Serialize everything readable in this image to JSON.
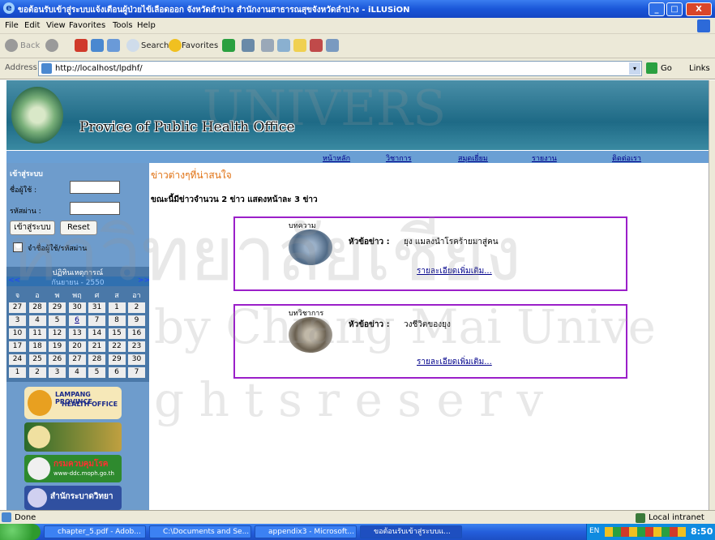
{
  "window": {
    "title": "ขอต้อนรับเข้าสู่ระบบแจ้งเตือนผู้ป่วยไข้เลือดออก จังหวัดลำปาง สำนักงานสาธารณสุขจังหวัดลำปาง - iLLUSiON"
  },
  "menu": [
    "File",
    "Edit",
    "View",
    "Favorites",
    "Tools",
    "Help"
  ],
  "toolbar": {
    "back": "Back",
    "search": "Search",
    "favorites": "Favorites"
  },
  "address": {
    "label": "Address",
    "url": "http://localhost/lpdhf/",
    "go": "Go",
    "links": "Links"
  },
  "banner": {
    "title": "Provice of Public Health Office"
  },
  "nav": [
    "หน้าหลัก",
    "วิชาการ",
    "สมุดเยี่ยม",
    "รายงาน",
    "ติดต่อเรา"
  ],
  "login": {
    "heading": "เข้าสู่ระบบ",
    "user_label": "ชื่อผู้ใช้ :",
    "pass_label": "รหัสผ่าน :",
    "login_button": "เข้าสู่ระบบ",
    "reset_button": "Reset",
    "remember": "จำชื่อผู้ใช้/รหัสผ่าน"
  },
  "calendar": {
    "title": "ปฏิทินเหตุการณ์",
    "month": "กันยายน - 2550",
    "prev": "<<",
    "next": ">>",
    "days": [
      "จ",
      "อ",
      "พ",
      "พฤ",
      "ศ",
      "ส",
      "อา"
    ],
    "weeks": [
      [
        "27",
        "28",
        "29",
        "30",
        "31",
        "1",
        "2"
      ],
      [
        "3",
        "4",
        "5",
        "6",
        "7",
        "8",
        "9"
      ],
      [
        "10",
        "11",
        "12",
        "13",
        "14",
        "15",
        "16"
      ],
      [
        "17",
        "18",
        "19",
        "20",
        "21",
        "22",
        "23"
      ],
      [
        "24",
        "25",
        "26",
        "27",
        "28",
        "29",
        "30"
      ],
      [
        "1",
        "2",
        "3",
        "4",
        "5",
        "6",
        "7"
      ]
    ]
  },
  "logos": {
    "lampang": [
      "LAMPANG PROVINCE",
      "HEALTH OFFICE"
    ],
    "dcc": [
      "กรมควบคุมโรค",
      "www-ddc.moph.go.th"
    ],
    "bureau": "สำนักระบาดวิทยา"
  },
  "news": {
    "heading": "ข่าวต่างๆที่น่าสนใจ",
    "count_text": "ขณะนี้มีข่าวจำนวน 2 ข่าว แสดงหน้าละ 3 ข่าว",
    "items": [
      {
        "category": "บทความ",
        "label": "หัวข้อข่าว :",
        "title": "ยุง แมลงนำโรคร้ายมาสู่คน",
        "more": "รายละเอียดเพิ่มเติม..."
      },
      {
        "category": "บทวิชาการ",
        "label": "หัวข้อข่าว :",
        "title": "วงชีวิตของยุง",
        "more": "รายละเอียดเพิ่มเติม..."
      }
    ]
  },
  "watermark": {
    "line1": "UNIVERS",
    "line2": "หาวิทยาลัยเชียง",
    "line3": "by Chiang Mai Unive",
    "line4": "g h t s   r e s e r v"
  },
  "status": {
    "left": "Done",
    "right": "Local intranet"
  },
  "taskbar": {
    "tasks": [
      "chapter_5.pdf - Adob...",
      "C:\\Documents and Se...",
      "appendix3 - Microsoft...",
      "ขอต้อนรับเข้าสู่ระบบแ..."
    ],
    "lang": "EN",
    "clock": "8:50"
  },
  "colors": {
    "purple_border": "#9b1fc9",
    "nav_blue": "#6a9fd4",
    "sidebar_blue": "#6e9ccc"
  }
}
